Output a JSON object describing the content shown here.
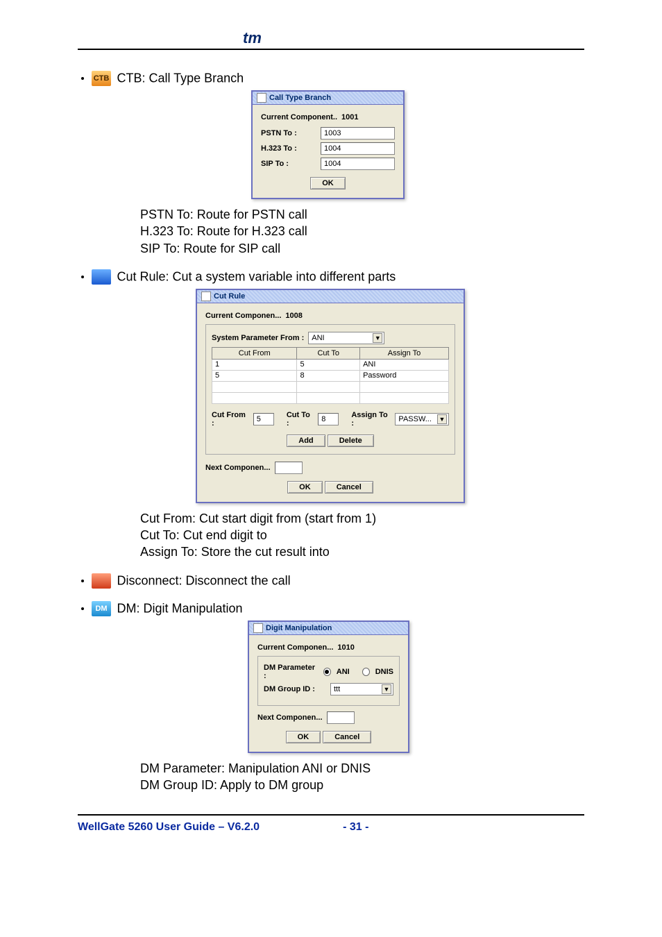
{
  "logo_text": "tm",
  "sections": {
    "ctb": {
      "label": "CTB: Call Type Branch",
      "dialog": {
        "title": "Call Type Branch",
        "current_label": "Current Component..",
        "current_value": "1001",
        "rows": {
          "pstn": {
            "label": "PSTN To :",
            "value": "1003"
          },
          "h323": {
            "label": "H.323 To :",
            "value": "1004"
          },
          "sip": {
            "label": "SIP To :",
            "value": "1004"
          }
        },
        "ok": "OK"
      },
      "notes": {
        "l1": "PSTN To: Route for PSTN call",
        "l2": "H.323 To: Route for H.323 call",
        "l3": "SIP To: Route for SIP call"
      }
    },
    "cutrule": {
      "label": "Cut Rule: Cut a system variable into different parts",
      "dialog": {
        "title": "Cut Rule",
        "current_label": "Current Componen...",
        "current_value": "1008",
        "sys_param_label": "System Parameter From :",
        "sys_param_value": "ANI",
        "cols": {
          "c1": "Cut From",
          "c2": "Cut To",
          "c3": "Assign To"
        },
        "rows": [
          {
            "from": "1",
            "to": "5",
            "assign": "ANI"
          },
          {
            "from": "5",
            "to": "8",
            "assign": "Password"
          }
        ],
        "cutfrom_label": "Cut From :",
        "cutfrom_value": "5",
        "cutto_label": "Cut To :",
        "cutto_value": "8",
        "assign_label": "Assign To :",
        "assign_value": "PASSW...",
        "add": "Add",
        "delete": "Delete",
        "next_label": "Next Componen...",
        "next_value": "",
        "ok": "OK",
        "cancel": "Cancel"
      },
      "notes": {
        "l1": "Cut From: Cut start digit from (start from 1)",
        "l2": "Cut To: Cut end digit to",
        "l3": "Assign To: Store the cut result into"
      }
    },
    "disconnect": {
      "label": "Disconnect: Disconnect the call"
    },
    "dm": {
      "label": "DM: Digit Manipulation",
      "dialog": {
        "title": "Digit Manipulation",
        "current_label": "Current Componen...",
        "current_value": "1010",
        "param_label": "DM Parameter :",
        "opt_ani": "ANI",
        "opt_dnis": "DNIS",
        "group_label": "DM Group ID :",
        "group_value": "ttt",
        "next_label": "Next Componen...",
        "next_value": "",
        "ok": "OK",
        "cancel": "Cancel"
      },
      "notes": {
        "l1": "DM Parameter: Manipulation ANI or DNIS",
        "l2": "DM Group ID: Apply to DM group"
      }
    }
  },
  "footer": {
    "left": "WellGate 5260 User Guide – V6.2.0",
    "right": "- 31 -"
  }
}
